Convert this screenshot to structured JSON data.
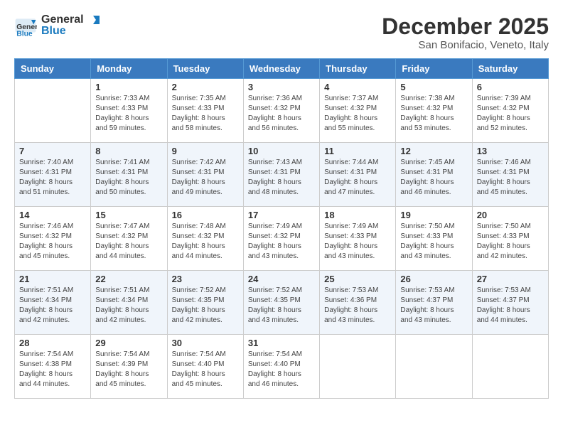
{
  "header": {
    "logo_general": "General",
    "logo_blue": "Blue",
    "month_title": "December 2025",
    "location": "San Bonifacio, Veneto, Italy"
  },
  "days_of_week": [
    "Sunday",
    "Monday",
    "Tuesday",
    "Wednesday",
    "Thursday",
    "Friday",
    "Saturday"
  ],
  "weeks": [
    [
      {
        "day": "",
        "sunrise": "",
        "sunset": "",
        "daylight": ""
      },
      {
        "day": "1",
        "sunrise": "Sunrise: 7:33 AM",
        "sunset": "Sunset: 4:33 PM",
        "daylight": "Daylight: 8 hours and 59 minutes."
      },
      {
        "day": "2",
        "sunrise": "Sunrise: 7:35 AM",
        "sunset": "Sunset: 4:33 PM",
        "daylight": "Daylight: 8 hours and 58 minutes."
      },
      {
        "day": "3",
        "sunrise": "Sunrise: 7:36 AM",
        "sunset": "Sunset: 4:32 PM",
        "daylight": "Daylight: 8 hours and 56 minutes."
      },
      {
        "day": "4",
        "sunrise": "Sunrise: 7:37 AM",
        "sunset": "Sunset: 4:32 PM",
        "daylight": "Daylight: 8 hours and 55 minutes."
      },
      {
        "day": "5",
        "sunrise": "Sunrise: 7:38 AM",
        "sunset": "Sunset: 4:32 PM",
        "daylight": "Daylight: 8 hours and 53 minutes."
      },
      {
        "day": "6",
        "sunrise": "Sunrise: 7:39 AM",
        "sunset": "Sunset: 4:32 PM",
        "daylight": "Daylight: 8 hours and 52 minutes."
      }
    ],
    [
      {
        "day": "7",
        "sunrise": "Sunrise: 7:40 AM",
        "sunset": "Sunset: 4:31 PM",
        "daylight": "Daylight: 8 hours and 51 minutes."
      },
      {
        "day": "8",
        "sunrise": "Sunrise: 7:41 AM",
        "sunset": "Sunset: 4:31 PM",
        "daylight": "Daylight: 8 hours and 50 minutes."
      },
      {
        "day": "9",
        "sunrise": "Sunrise: 7:42 AM",
        "sunset": "Sunset: 4:31 PM",
        "daylight": "Daylight: 8 hours and 49 minutes."
      },
      {
        "day": "10",
        "sunrise": "Sunrise: 7:43 AM",
        "sunset": "Sunset: 4:31 PM",
        "daylight": "Daylight: 8 hours and 48 minutes."
      },
      {
        "day": "11",
        "sunrise": "Sunrise: 7:44 AM",
        "sunset": "Sunset: 4:31 PM",
        "daylight": "Daylight: 8 hours and 47 minutes."
      },
      {
        "day": "12",
        "sunrise": "Sunrise: 7:45 AM",
        "sunset": "Sunset: 4:31 PM",
        "daylight": "Daylight: 8 hours and 46 minutes."
      },
      {
        "day": "13",
        "sunrise": "Sunrise: 7:46 AM",
        "sunset": "Sunset: 4:31 PM",
        "daylight": "Daylight: 8 hours and 45 minutes."
      }
    ],
    [
      {
        "day": "14",
        "sunrise": "Sunrise: 7:46 AM",
        "sunset": "Sunset: 4:32 PM",
        "daylight": "Daylight: 8 hours and 45 minutes."
      },
      {
        "day": "15",
        "sunrise": "Sunrise: 7:47 AM",
        "sunset": "Sunset: 4:32 PM",
        "daylight": "Daylight: 8 hours and 44 minutes."
      },
      {
        "day": "16",
        "sunrise": "Sunrise: 7:48 AM",
        "sunset": "Sunset: 4:32 PM",
        "daylight": "Daylight: 8 hours and 44 minutes."
      },
      {
        "day": "17",
        "sunrise": "Sunrise: 7:49 AM",
        "sunset": "Sunset: 4:32 PM",
        "daylight": "Daylight: 8 hours and 43 minutes."
      },
      {
        "day": "18",
        "sunrise": "Sunrise: 7:49 AM",
        "sunset": "Sunset: 4:33 PM",
        "daylight": "Daylight: 8 hours and 43 minutes."
      },
      {
        "day": "19",
        "sunrise": "Sunrise: 7:50 AM",
        "sunset": "Sunset: 4:33 PM",
        "daylight": "Daylight: 8 hours and 43 minutes."
      },
      {
        "day": "20",
        "sunrise": "Sunrise: 7:50 AM",
        "sunset": "Sunset: 4:33 PM",
        "daylight": "Daylight: 8 hours and 42 minutes."
      }
    ],
    [
      {
        "day": "21",
        "sunrise": "Sunrise: 7:51 AM",
        "sunset": "Sunset: 4:34 PM",
        "daylight": "Daylight: 8 hours and 42 minutes."
      },
      {
        "day": "22",
        "sunrise": "Sunrise: 7:51 AM",
        "sunset": "Sunset: 4:34 PM",
        "daylight": "Daylight: 8 hours and 42 minutes."
      },
      {
        "day": "23",
        "sunrise": "Sunrise: 7:52 AM",
        "sunset": "Sunset: 4:35 PM",
        "daylight": "Daylight: 8 hours and 42 minutes."
      },
      {
        "day": "24",
        "sunrise": "Sunrise: 7:52 AM",
        "sunset": "Sunset: 4:35 PM",
        "daylight": "Daylight: 8 hours and 43 minutes."
      },
      {
        "day": "25",
        "sunrise": "Sunrise: 7:53 AM",
        "sunset": "Sunset: 4:36 PM",
        "daylight": "Daylight: 8 hours and 43 minutes."
      },
      {
        "day": "26",
        "sunrise": "Sunrise: 7:53 AM",
        "sunset": "Sunset: 4:37 PM",
        "daylight": "Daylight: 8 hours and 43 minutes."
      },
      {
        "day": "27",
        "sunrise": "Sunrise: 7:53 AM",
        "sunset": "Sunset: 4:37 PM",
        "daylight": "Daylight: 8 hours and 44 minutes."
      }
    ],
    [
      {
        "day": "28",
        "sunrise": "Sunrise: 7:54 AM",
        "sunset": "Sunset: 4:38 PM",
        "daylight": "Daylight: 8 hours and 44 minutes."
      },
      {
        "day": "29",
        "sunrise": "Sunrise: 7:54 AM",
        "sunset": "Sunset: 4:39 PM",
        "daylight": "Daylight: 8 hours and 45 minutes."
      },
      {
        "day": "30",
        "sunrise": "Sunrise: 7:54 AM",
        "sunset": "Sunset: 4:40 PM",
        "daylight": "Daylight: 8 hours and 45 minutes."
      },
      {
        "day": "31",
        "sunrise": "Sunrise: 7:54 AM",
        "sunset": "Sunset: 4:40 PM",
        "daylight": "Daylight: 8 hours and 46 minutes."
      },
      {
        "day": "",
        "sunrise": "",
        "sunset": "",
        "daylight": ""
      },
      {
        "day": "",
        "sunrise": "",
        "sunset": "",
        "daylight": ""
      },
      {
        "day": "",
        "sunrise": "",
        "sunset": "",
        "daylight": ""
      }
    ]
  ]
}
